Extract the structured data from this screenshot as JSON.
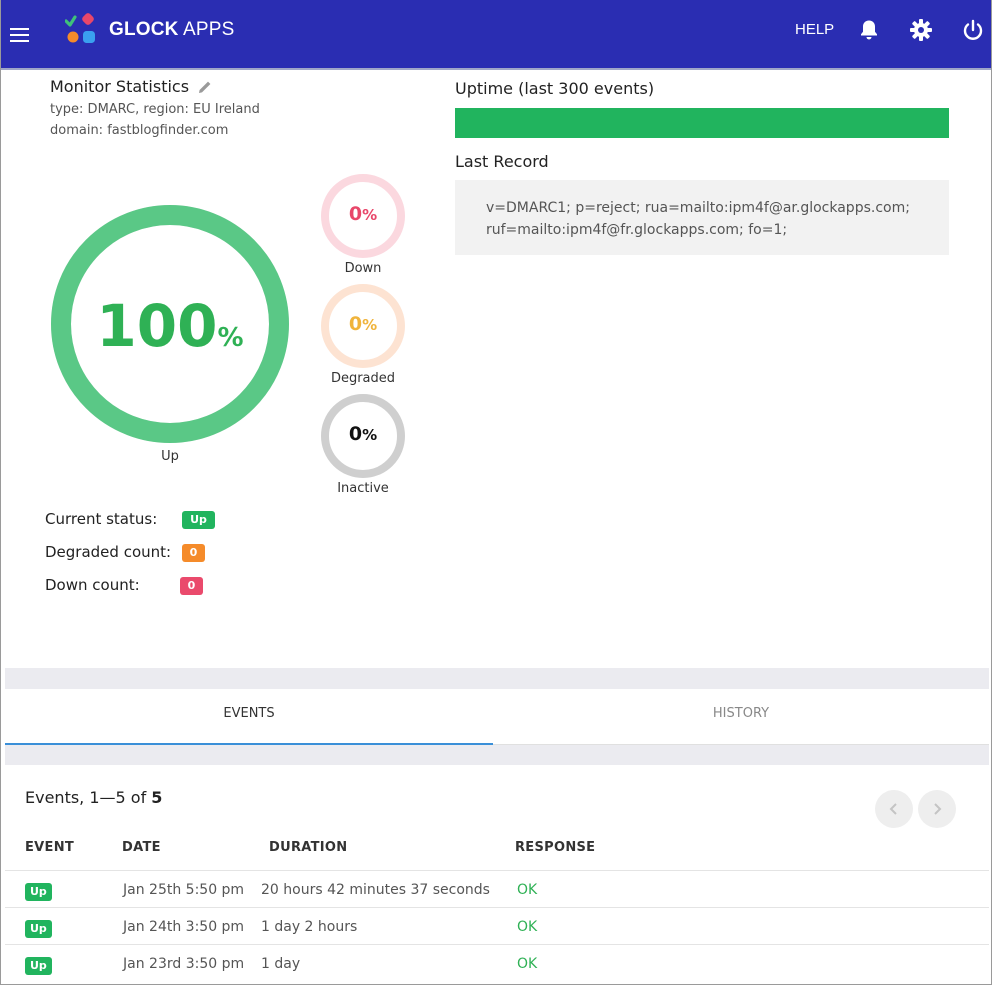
{
  "header": {
    "brand_bold": "GLOCK",
    "brand_light": "APPS",
    "help_label": "HELP",
    "icons": [
      "menu-icon",
      "bell-icon",
      "gear-icon",
      "power-icon"
    ]
  },
  "monitor": {
    "title": "Monitor Statistics",
    "type_line": "type: DMARC, region: EU Ireland",
    "domain_line": "domain: fastblogfinder.com",
    "up": {
      "value": "100",
      "unit": "%",
      "label": "Up",
      "fraction": 1.0,
      "color": "#5ac886"
    },
    "down": {
      "value": "0",
      "unit": "%",
      "label": "Down",
      "fraction": 0,
      "color": "#e8476a"
    },
    "degraded": {
      "value": "0",
      "unit": "%",
      "label": "Degraded",
      "fraction": 0,
      "color": "#f0b43c"
    },
    "inactive": {
      "value": "0",
      "unit": "%",
      "label": "Inactive",
      "fraction": 0,
      "color": "#111111"
    },
    "current_status_label": "Current status:",
    "current_status": "Up",
    "degraded_count_label": "Degraded count:",
    "degraded_count": "0",
    "down_count_label": "Down count:",
    "down_count": "0"
  },
  "uptime": {
    "title": "Uptime (last 300 events)",
    "fraction": 1.0
  },
  "last_record": {
    "title": "Last Record",
    "line1": "v=DMARC1; p=reject; rua=mailto:ipm4f@ar.glockapps.com;",
    "line2": "ruf=mailto:ipm4f@fr.glockapps.com; fo=1;"
  },
  "tabs": [
    {
      "label": "EVENTS",
      "active": true
    },
    {
      "label": "HISTORY",
      "active": false
    }
  ],
  "events": {
    "summary_prefix": "Events, 1—5 of ",
    "total": "5",
    "columns": [
      "EVENT",
      "DATE",
      "DURATION",
      "RESPONSE"
    ],
    "rows": [
      {
        "event": "Up",
        "date": "Jan 25th 5:50 pm",
        "duration": "20 hours 42 minutes 37 seconds",
        "response": "OK"
      },
      {
        "event": "Up",
        "date": "Jan 24th 3:50 pm",
        "duration": "1 day 2 hours",
        "response": "OK"
      },
      {
        "event": "Up",
        "date": "Jan 23rd 3:50 pm",
        "duration": "1 day",
        "response": "OK"
      }
    ]
  },
  "colors": {
    "topbar": "#2a2db2",
    "up_green": "#21b45e",
    "degraded_orange": "#f58b2a",
    "down_red": "#ea4a6c",
    "tab_active": "#3a8fd8"
  }
}
